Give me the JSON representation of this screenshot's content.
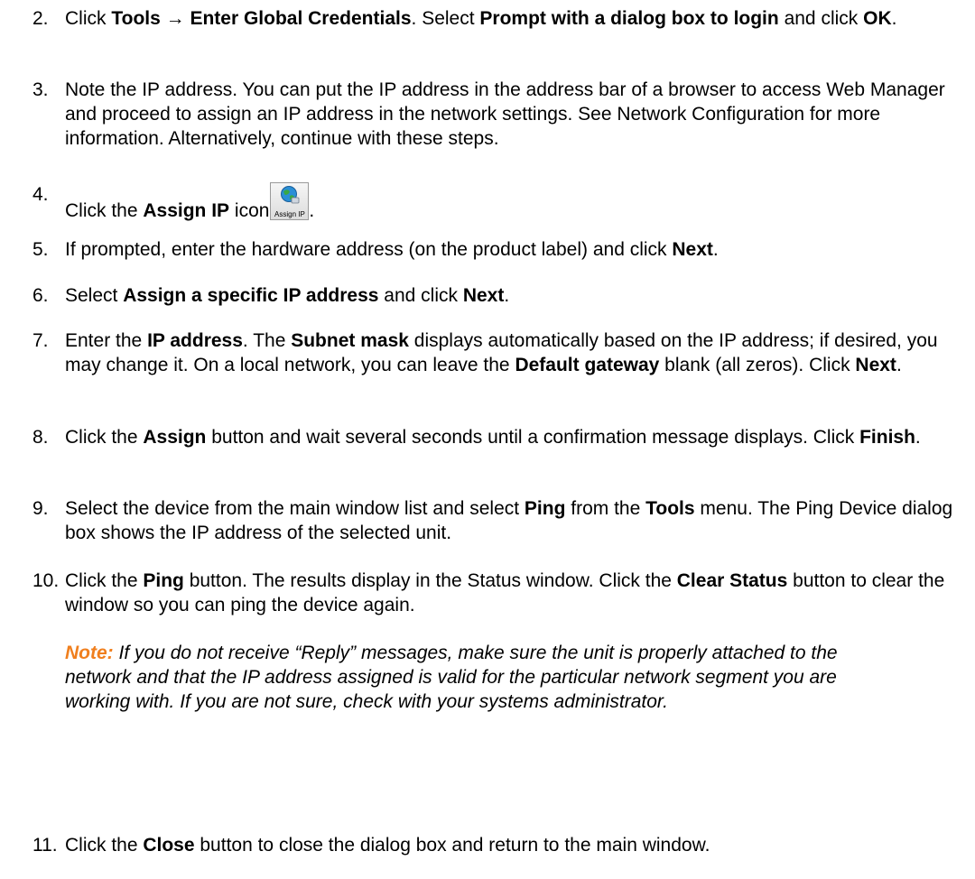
{
  "steps": [
    {
      "number": "2.",
      "parts": [
        {
          "t": "Click "
        },
        {
          "b": "Tools "
        },
        {
          "arrow": "→"
        },
        {
          "b": " Enter Global Credentials"
        },
        {
          "t": ". Select "
        },
        {
          "b": "Prompt with a dialog box to login"
        },
        {
          "t": " and click "
        },
        {
          "b": "OK"
        },
        {
          "t": "."
        }
      ]
    },
    {
      "number": "3.",
      "parts": [
        {
          "t": "Note the IP address. You can put the IP address in the address bar of a browser to access Web Manager and proceed to assign an IP address in the network settings. See Network Configuration for more information. Alternatively, continue with these steps."
        }
      ]
    },
    {
      "number": "4.",
      "parts": [
        {
          "t": "Click the "
        },
        {
          "b": "Assign IP"
        },
        {
          "t": " icon"
        },
        {
          "icon": "assign-ip"
        },
        {
          "t": "."
        }
      ]
    },
    {
      "number": "5.",
      "parts": [
        {
          "t": "If prompted, enter the hardware address (on the product label) and click "
        },
        {
          "b": "Next"
        },
        {
          "t": "."
        }
      ]
    },
    {
      "number": "6.",
      "parts": [
        {
          "t": "Select "
        },
        {
          "b": "Assign a specific IP address"
        },
        {
          "t": " and click "
        },
        {
          "b": "Next"
        },
        {
          "t": "."
        }
      ]
    },
    {
      "number": "7.",
      "parts": [
        {
          "t": "Enter the "
        },
        {
          "b": "IP address"
        },
        {
          "t": ". The "
        },
        {
          "b": "Subnet mask"
        },
        {
          "t": " displays automatically based on the IP address; if desired, you may change it. On a local network, you can leave the "
        },
        {
          "b": "Default gateway"
        },
        {
          "t": " blank (all zeros). Click "
        },
        {
          "b": "Next"
        },
        {
          "t": "."
        }
      ]
    },
    {
      "number": "8.",
      "parts": [
        {
          "t": "Click the "
        },
        {
          "b": "Assign"
        },
        {
          "t": " button and wait several seconds until a confirmation message displays. Click "
        },
        {
          "b": "Finish"
        },
        {
          "t": "."
        }
      ]
    },
    {
      "number": "9.",
      "parts": [
        {
          "t": "Select the device from the main window list and select "
        },
        {
          "b": "Ping"
        },
        {
          "t": " from the "
        },
        {
          "b": "Tools"
        },
        {
          "t": " menu. The Ping Device dialog box shows the IP address of the selected unit."
        }
      ]
    },
    {
      "number": "10.",
      "parts": [
        {
          "t": "Click the "
        },
        {
          "b": "Ping"
        },
        {
          "t": " button. The results display in the Status window. Click the "
        },
        {
          "b": "Clear Status"
        },
        {
          "t": " button to clear the window so you can ping the device again."
        }
      ]
    },
    {
      "number": "11.",
      "parts": [
        {
          "t": "Click the "
        },
        {
          "b": "Close"
        },
        {
          "t": " button to close the dialog box and return to the main window."
        }
      ]
    }
  ],
  "note": {
    "label": "Note:",
    "text": " If you do not receive “Reply” messages, make sure the unit is properly attached to the network and that the IP address assigned is valid for the particular network segment you are working with. If you are not sure, check with your systems administrator."
  },
  "assign_ip_icon": {
    "icon": "globe-network-icon",
    "label": "Assign IP"
  },
  "colors": {
    "note_label": "#f07f1e",
    "text": "#000000"
  }
}
